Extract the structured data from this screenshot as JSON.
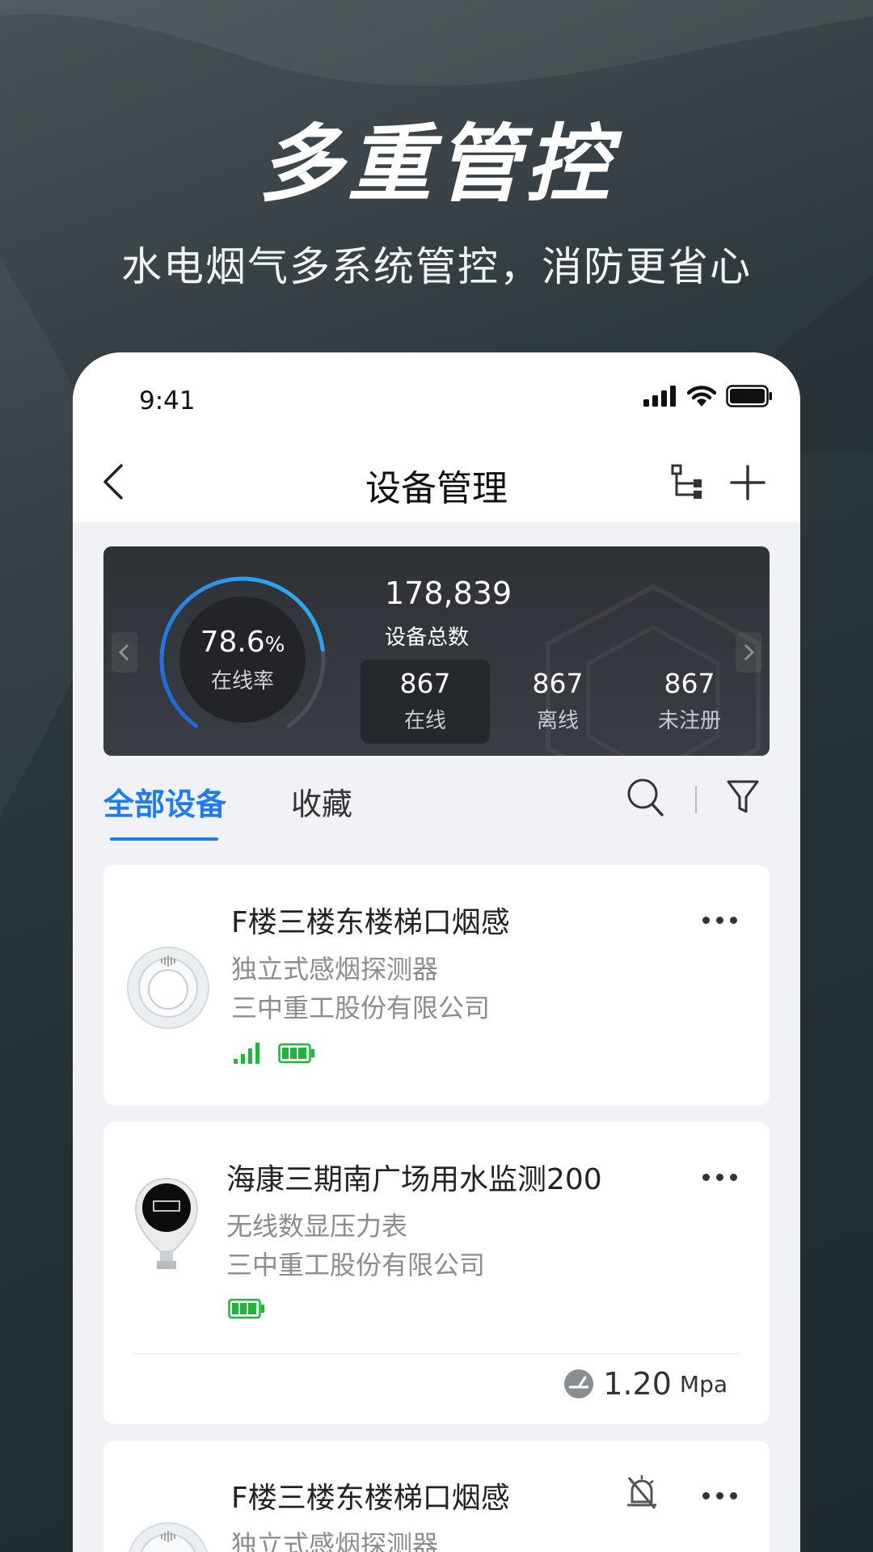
{
  "hero": {
    "title": "多重管控",
    "subtitle": "水电烟气多系统管控，消防更省心"
  },
  "status_bar": {
    "time": "9:41",
    "icons": [
      "cellular-signal-icon",
      "wifi-icon",
      "battery-icon"
    ]
  },
  "nav": {
    "title": "设备管理",
    "icons": [
      "back-arrow-icon",
      "tree-structure-icon",
      "plus-icon"
    ]
  },
  "stats": {
    "online_rate_value": "78.6",
    "online_rate_unit": "%",
    "online_rate_fraction": 0.786,
    "online_rate_label": "在线率",
    "total": "178,839",
    "total_label": "设备总数",
    "items": [
      {
        "value": "867",
        "label": "在线",
        "active": true
      },
      {
        "value": "867",
        "label": "离线",
        "active": false
      },
      {
        "value": "867",
        "label": "未注册",
        "active": false
      }
    ]
  },
  "tabs": [
    {
      "label": "全部设备",
      "active": true
    },
    {
      "label": "收藏",
      "active": false
    }
  ],
  "devices": [
    {
      "name": "F楼三楼东楼梯口烟感",
      "type": "独立式感烟探测器",
      "company": "三中重工股份有限公司",
      "icons": [
        "signal-strength-icon",
        "battery-icon"
      ]
    },
    {
      "name": "海康三期南广场用水监测200",
      "type": "无线数显压力表",
      "company": "三中重工股份有限公司",
      "icons": [
        "battery-icon"
      ],
      "reading": "1.20",
      "reading_unit": "Mpa"
    },
    {
      "name": "F楼三楼东楼梯口烟感",
      "type": "独立式感烟探测器",
      "icons": [
        "alarm-muted-icon"
      ]
    }
  ],
  "colors": {
    "accent": "#1f7cf0",
    "signal_green": "#1fb53a",
    "card_bg": "#ffffff",
    "list_bg": "#f1f2f5"
  }
}
